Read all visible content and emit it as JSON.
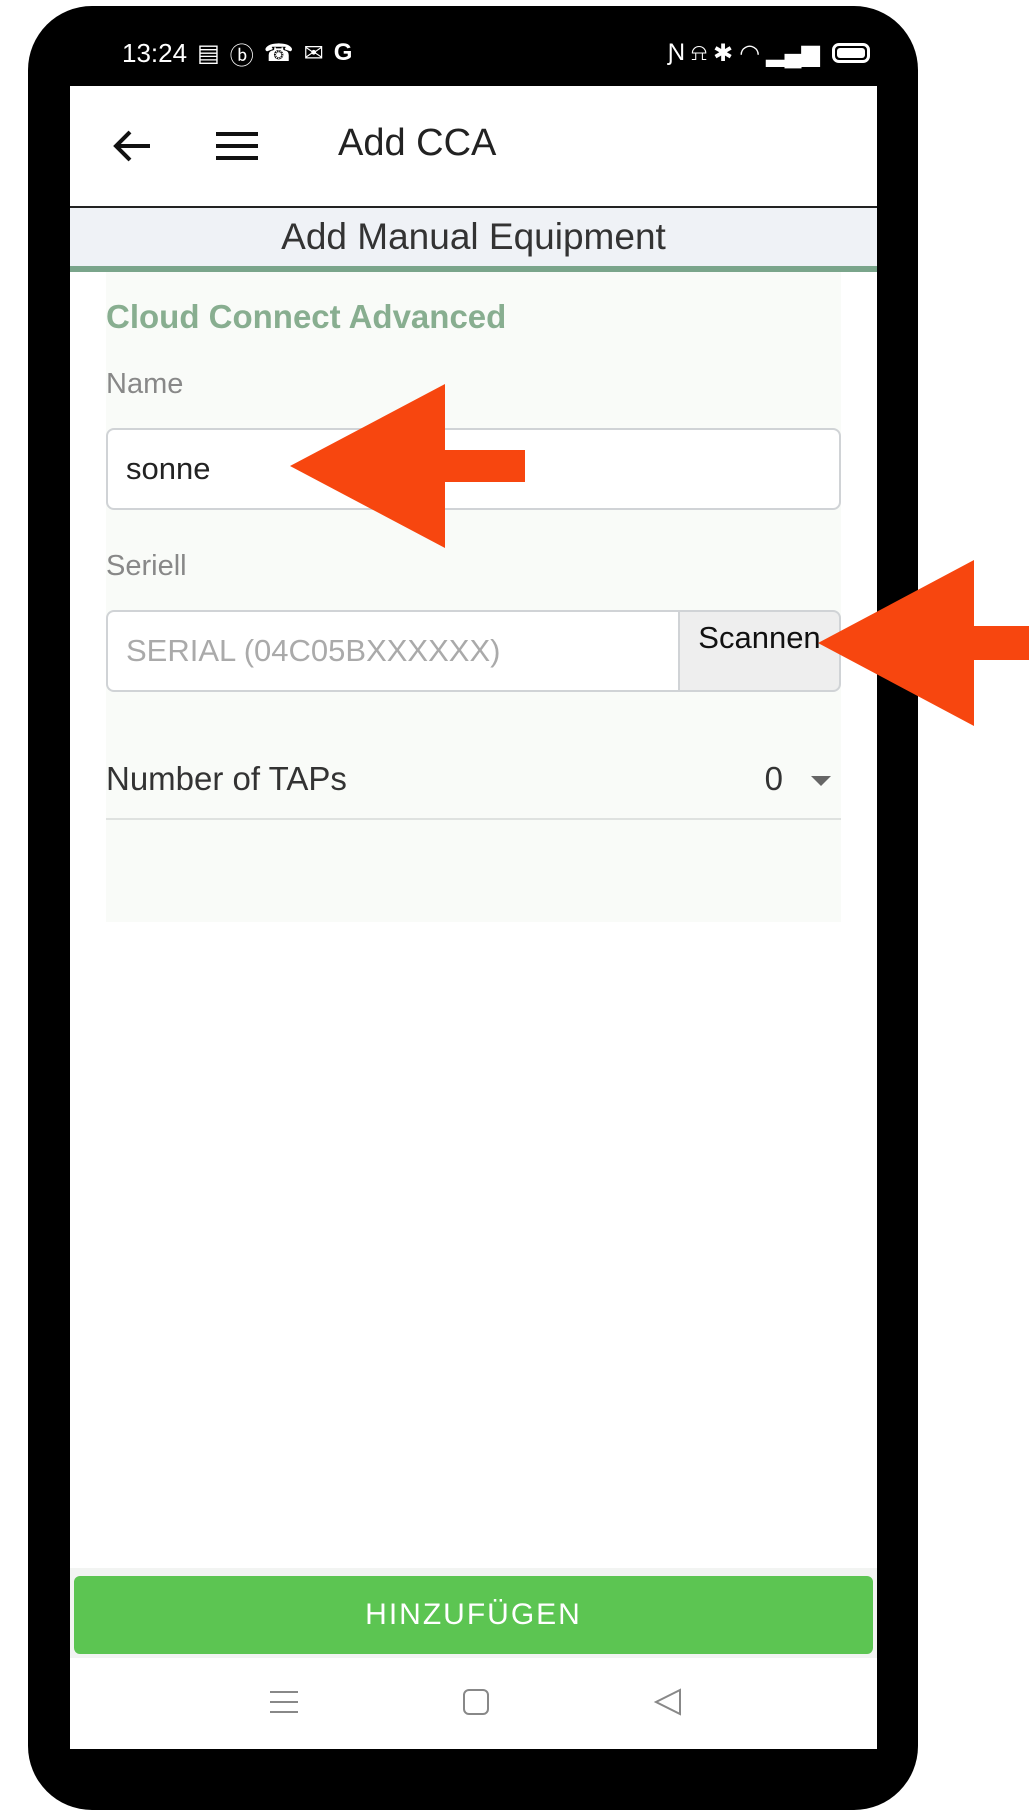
{
  "status_bar": {
    "time": "13:24",
    "left_icons": [
      "notes-icon",
      "b-circle-icon",
      "missed-call-icon",
      "gmail-icon",
      "google-icon"
    ],
    "right_icons": [
      "nfc-icon",
      "vibrate-icon",
      "bluetooth-icon",
      "wifi-icon",
      "signal-icon",
      "battery-icon"
    ]
  },
  "app_bar": {
    "title": "Add CCA",
    "back_icon": "arrow-left-icon",
    "menu_icon": "hamburger-menu-icon"
  },
  "subheader": {
    "title": "Add Manual Equipment"
  },
  "form": {
    "section_title": "Cloud Connect Advanced",
    "name_label": "Name",
    "name_value": "sonne",
    "serial_label": "Seriell",
    "serial_placeholder": "SERIAL (04C05BXXXXXX)",
    "scan_label": "Scannen",
    "taps_label": "Number of TAPs",
    "taps_value": "0"
  },
  "footer": {
    "add_label": "HINZUFÜGEN"
  },
  "nav_bar": {
    "icons": [
      "recent-apps-icon",
      "home-icon",
      "back-triangle-icon"
    ]
  },
  "colors": {
    "accent_green": "#5cc552",
    "section_green": "#88ae90",
    "annotation_arrow": "#f7460f"
  }
}
